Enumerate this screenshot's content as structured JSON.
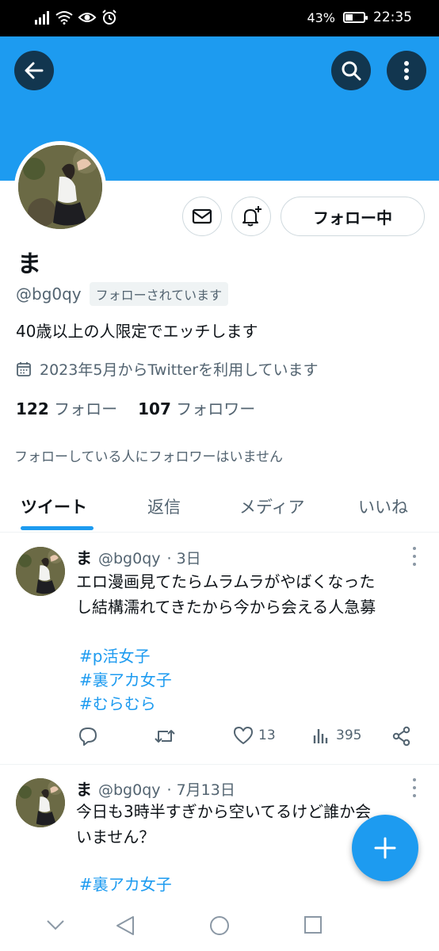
{
  "status_bar": {
    "battery_text": "43%",
    "battery_level": 0.43,
    "time": "22:35"
  },
  "colors": {
    "accent": "#1d9bf0",
    "text": "#0f1419",
    "secondary_text": "#536471"
  },
  "header": {
    "back_icon": "arrow-left-icon",
    "search_icon": "search-icon",
    "more_icon": "more-vertical-icon"
  },
  "profile": {
    "name": "ま",
    "handle": "@bg0qy",
    "follows_you": "フォローされています",
    "bio": "40歳以上の人限定でエッチします",
    "joined": "2023年5月からTwitterを利用しています",
    "following_count": "122",
    "following_label": "フォロー",
    "followers_count": "107",
    "followers_label": "フォロワー",
    "no_common_followers": "フォローしている人にフォロワーはいません",
    "follow_button": "フォロー中"
  },
  "tabs": [
    {
      "label": "ツイート",
      "active": true
    },
    {
      "label": "返信",
      "active": false
    },
    {
      "label": "メディア",
      "active": false
    },
    {
      "label": "いいね",
      "active": false
    }
  ],
  "tweets": [
    {
      "name": "ま",
      "handle": "@bg0qy",
      "time": "· 3日",
      "text_line1": "エロ漫画見てたらムラムラがやばくなった",
      "text_line2": "し結構濡れてきたから今から会える人急募",
      "hashtags": [
        "#p活女子",
        "#裏アカ女子",
        "#むらむら"
      ],
      "likes": "13",
      "views": "395"
    },
    {
      "name": "ま",
      "handle": "@bg0qy",
      "time": "· 7月13日",
      "text_line1": "今日も3時半すぎから空いてるけど誰か会",
      "text_line2": "いません？",
      "hashtags": [
        "#裏アカ女子"
      ]
    }
  ]
}
